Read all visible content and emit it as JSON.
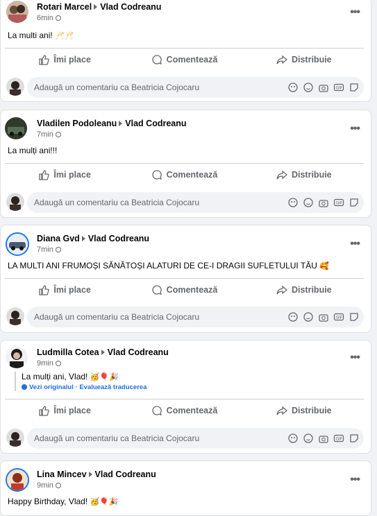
{
  "actions": {
    "like": "Îmi place",
    "comment": "Comentează",
    "share": "Distribuie"
  },
  "comment_placeholder": "Adaugă un comentariu ca Beatricia Cojocaru",
  "recipient": "Vlad Codreanu",
  "posts": [
    {
      "author": "Rotari Marcel",
      "time": "6min",
      "text": "La multi ani!",
      "emoji": "🥂🥂"
    },
    {
      "author": "Vladilen Podoleanu",
      "time": "7min",
      "text": "La mulți ani!!!",
      "emoji": ""
    },
    {
      "author": "Diana Gvd",
      "time": "7min",
      "text": "LA MULTI ANI FRUMOȘI SĂNĂTOȘI ALATURI DE CE-I DRAGII SUFLETULUI TĂU",
      "emoji": "🥰"
    },
    {
      "author": "Ludmilla Cotea",
      "time": "9min",
      "text": "La mulți ani, Vlad!",
      "emoji": "🥳🎈🎉",
      "see_original": "Vezi originalul",
      "rate_translation": "Evaluează traducerea",
      "sep": " · "
    },
    {
      "author": "Lina Mincev",
      "time": "9min",
      "text": "Happy Birthday, Vlad!",
      "emoji": "🥳🎈🎉"
    }
  ],
  "colors": {
    "page_bg": "#f0f2f5",
    "card_bg": "#ffffff",
    "secondary_text": "#65676b",
    "link": "#216fdb"
  },
  "icons": [
    "like-icon",
    "comment-icon",
    "share-icon",
    "more-icon",
    "globe-icon",
    "sticker-icon",
    "emoji-icon",
    "camera-icon",
    "gif-icon",
    "avatar-icon"
  ]
}
